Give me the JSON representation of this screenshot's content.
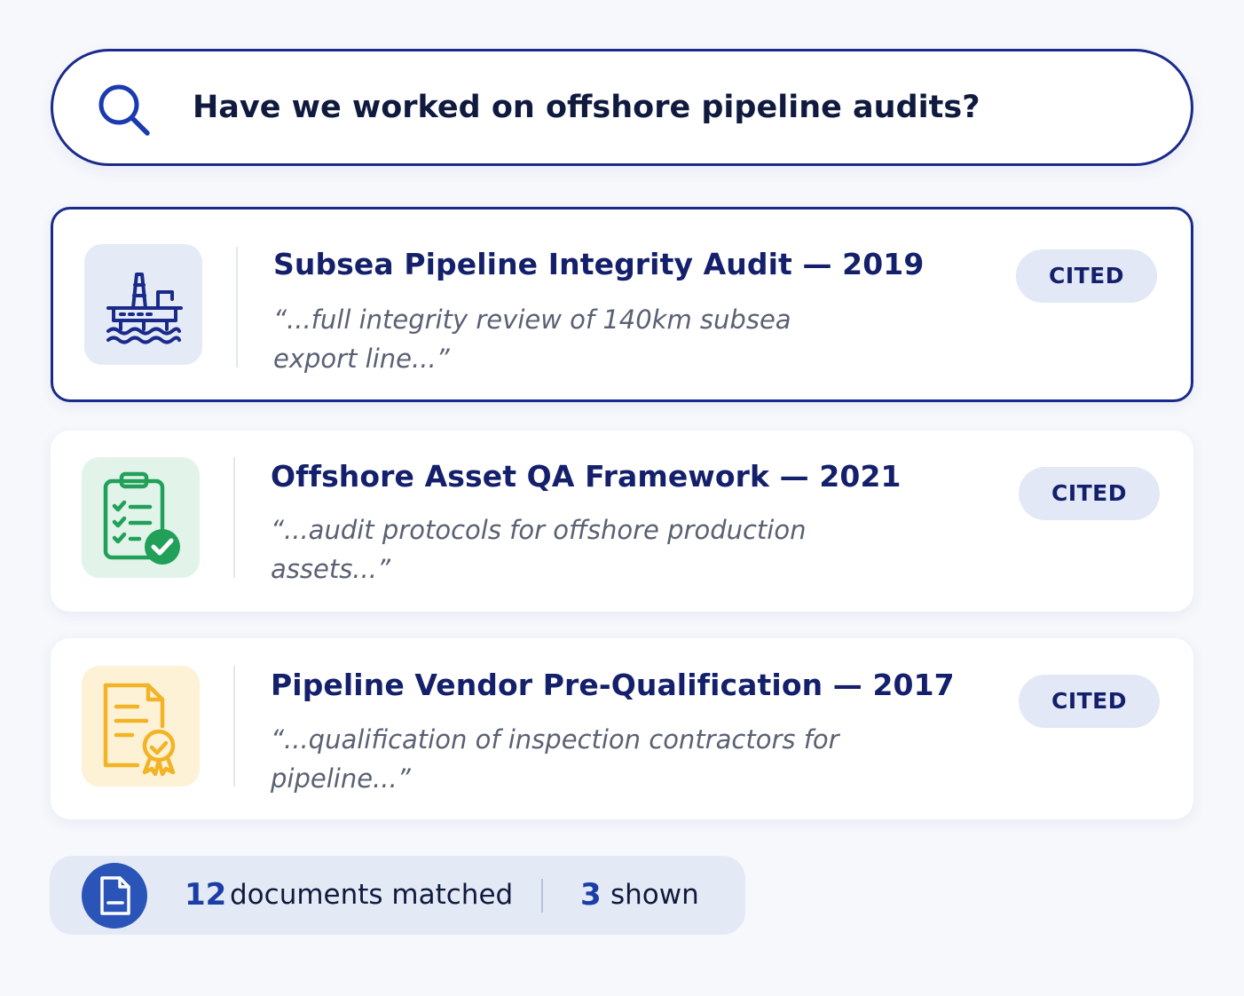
{
  "search": {
    "query": "Have we worked on offshore pipeline audits?",
    "icon": "search-icon"
  },
  "results": [
    {
      "title": "Subsea Pipeline Integrity Audit — 2019",
      "snippet": "“...full integrity review of 140km subsea export line...”",
      "badge": "CITED",
      "icon": "offshore-platform-icon",
      "selected": true,
      "accent": "#1a2a8a"
    },
    {
      "title": "Offshore Asset QA Framework — 2021",
      "snippet": "“...audit protocols for offshore production assets...”",
      "badge": "CITED",
      "icon": "clipboard-check-icon",
      "selected": false,
      "accent": "#21a05a"
    },
    {
      "title": "Pipeline Vendor Pre-Qualification — 2017",
      "snippet": "“...qualification of inspection contractors for pipeline...”",
      "badge": "CITED",
      "icon": "certificate-document-icon",
      "selected": false,
      "accent": "#f2b425"
    }
  ],
  "stats": {
    "matched_count": "12",
    "matched_label": "documents matched",
    "shown_count": "3",
    "shown_label": "shown",
    "icon": "document-icon"
  },
  "colors": {
    "primary": "#1a2a8a",
    "badge_bg": "#e2e8f6",
    "stats_accent": "#2a54b7"
  }
}
